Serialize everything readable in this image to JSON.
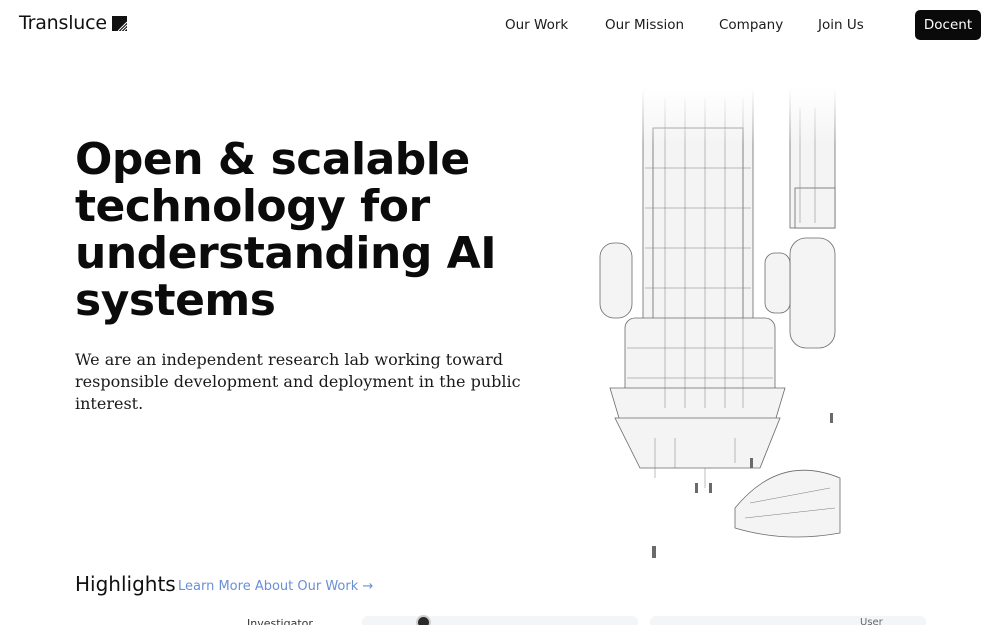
{
  "brand": {
    "name": "Transluce",
    "logo_icon": "transluce-logo-icon"
  },
  "nav": {
    "items": [
      {
        "label": "Our Work"
      },
      {
        "label": "Our Mission"
      },
      {
        "label": "Company"
      },
      {
        "label": "Join Us"
      }
    ],
    "cta_label": "Docent"
  },
  "hero": {
    "title": "Open & scalable technology for understanding AI systems",
    "subtitle": "We are an independent research lab working toward responsible development and deployment in the public interest."
  },
  "highlights": {
    "title": "Highlights",
    "link_label": "Learn More About Our Work →",
    "cards": [
      {
        "label": "Investigator"
      },
      {
        "label": "User"
      }
    ]
  },
  "colors": {
    "accent_link": "#6b8fd6",
    "button_bg": "#0a0a0a",
    "text": "#0b0b0b"
  }
}
